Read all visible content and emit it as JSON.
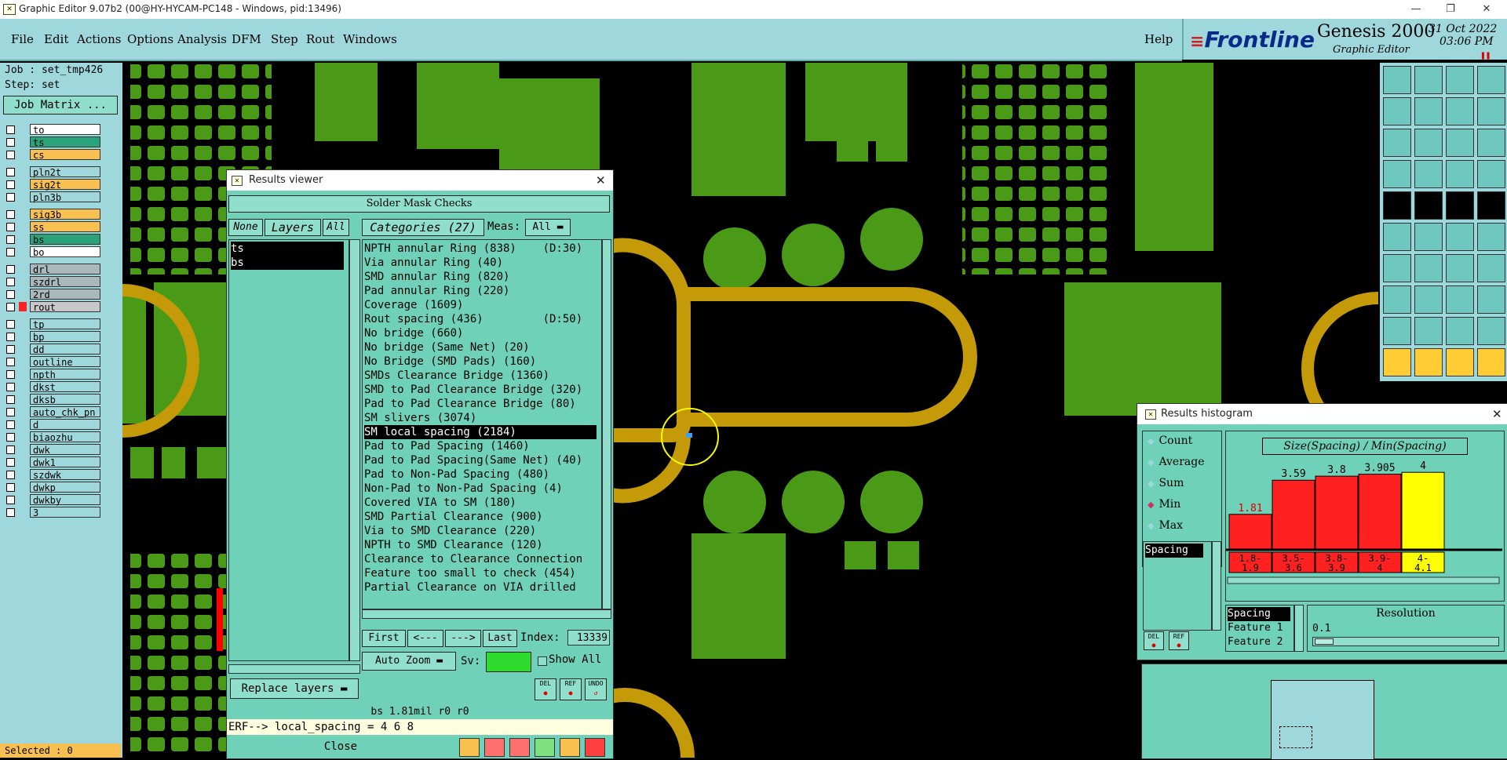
{
  "window": {
    "title": "Graphic Editor 9.07b2 (00@HY-HYCAM-PC148 - Windows, pid:13496)"
  },
  "menu": [
    "File",
    "Edit",
    "Actions",
    "Options",
    "Analysis",
    "DFM",
    "Step",
    "Rout",
    "Windows"
  ],
  "help": "Help",
  "brand": {
    "logo": "Frontline",
    "product": "Genesis 2000",
    "subtitle": "Graphic Editor",
    "date": "31 Oct 2022",
    "time": "03:06 PM"
  },
  "job": {
    "job": "Job : set_tmp426",
    "step": "Step: set",
    "matrix": "Job Matrix ..."
  },
  "layers": [
    {
      "name": "to",
      "color": "#ffffff"
    },
    {
      "name": "ts",
      "color": "#2aa37a"
    },
    {
      "name": "cs",
      "color": "#f8c050"
    },
    {
      "name": "pln2t",
      "color": "#9fd8dc"
    },
    {
      "name": "sig2t",
      "color": "#f8c050"
    },
    {
      "name": "pln3b",
      "color": "#9fd8dc"
    },
    {
      "name": "sig3b",
      "color": "#f8c050"
    },
    {
      "name": "ss",
      "color": "#f8c050"
    },
    {
      "name": "bs",
      "color": "#2aa37a"
    },
    {
      "name": "bo",
      "color": "#ffffff"
    },
    {
      "name": "drl",
      "color": "#a8b8bc"
    },
    {
      "name": "szdrl",
      "color": "#a8b8bc"
    },
    {
      "name": "2rd",
      "color": "#a8b8bc"
    },
    {
      "name": "rout",
      "color": "#c8c8c8"
    },
    {
      "name": "tp",
      "color": "#9fd8dc"
    },
    {
      "name": "bp",
      "color": "#9fd8dc"
    },
    {
      "name": "dd",
      "color": "#9fd8dc"
    },
    {
      "name": "outline",
      "color": "#9fd8dc"
    },
    {
      "name": "npth",
      "color": "#9fd8dc"
    },
    {
      "name": "dkst",
      "color": "#9fd8dc"
    },
    {
      "name": "dksb",
      "color": "#9fd8dc"
    },
    {
      "name": "auto_chk_pn",
      "color": "#9fd8dc"
    },
    {
      "name": "d",
      "color": "#9fd8dc"
    },
    {
      "name": "biaozhu",
      "color": "#9fd8dc"
    },
    {
      "name": "dwk",
      "color": "#9fd8dc"
    },
    {
      "name": "dwk1",
      "color": "#9fd8dc"
    },
    {
      "name": "szdwk",
      "color": "#9fd8dc"
    },
    {
      "name": "dwkp",
      "color": "#9fd8dc"
    },
    {
      "name": "dwkby",
      "color": "#9fd8dc"
    },
    {
      "name": "3",
      "color": "#9fd8dc"
    }
  ],
  "status": {
    "selected": "Selected : 0"
  },
  "results_viewer": {
    "title": "Results viewer",
    "header": "Solder Mask Checks",
    "none": "None",
    "layers": "Layers",
    "all": "All",
    "categories": "Categories (27)",
    "meas_label": "Meas:",
    "meas_value": "All",
    "layer_list": [
      "ts",
      "bs"
    ],
    "category_list": [
      "NPTH annular Ring (838)    (D:30)",
      "Via annular Ring (40)",
      "SMD annular Ring (820)",
      "Pad annular Ring (220)",
      "Coverage (1609)",
      "Rout spacing (436)         (D:50)",
      "No bridge (660)",
      "No bridge (Same Net) (20)",
      "No Bridge (SMD Pads) (160)",
      "SMDs Clearance Bridge (1360)",
      "SMD to Pad Clearance Bridge (320)",
      "Pad to Pad Clearance Bridge (80)",
      "SM slivers (3074)",
      "SM local spacing (2184)",
      "Pad to Pad Spacing (1460)",
      "Pad to Pad Spacing(Same Net) (40)",
      "Pad to Non-Pad Spacing (480)",
      "Non-Pad to Non-Pad Spacing (4)",
      "Covered VIA to SM (180)",
      "SMD Partial Clearance (900)",
      "Via to SMD Clearance (220)",
      "NPTH to SMD Clearance (120)",
      "Clearance to Clearance Connection",
      "Feature too small to check (454)",
      "Partial Clearance on VIA drilled"
    ],
    "selected_index": 13,
    "first": "First",
    "prev": "<---",
    "next": "--->",
    "last": "Last",
    "index_label": "Index:",
    "index_value": "13339",
    "auto_zoom": "Auto Zoom",
    "sv": "Sv:",
    "show_all": "Show All",
    "replace_layers": "Replace layers",
    "del": "DEL",
    "ref": "REF",
    "undo": "UNDO",
    "info": "bs 1.81mil  r0  r0",
    "erf": "ERF--> local_spacing = 4 6 8",
    "close": "Close"
  },
  "histogram": {
    "title": "Results histogram",
    "options": [
      "Count",
      "Average",
      "Sum",
      "Min",
      "Max"
    ],
    "selected_option": "Min",
    "field": "Spacing",
    "heading": "Size(Spacing) / Min(Spacing)",
    "del": "DEL",
    "ref": "REF",
    "attrs": [
      "Spacing",
      "Feature 1",
      "Feature 2"
    ],
    "resolution_label": "Resolution",
    "resolution_value": "0.1",
    "red": "#ff2020",
    "yellow": "#ffff00"
  },
  "chart_data": {
    "type": "bar",
    "categories": [
      "1.8-1.9",
      "3.5-3.6",
      "3.8-3.9",
      "3.9-4",
      "4-4.1"
    ],
    "values": [
      1.81,
      3.59,
      3.8,
      3.905,
      4
    ],
    "value_labels": [
      "1.81",
      "3.59",
      "3.8",
      "3.905",
      "4"
    ],
    "title": "Size(Spacing) / Min(Spacing)",
    "ylim": [
      0,
      4.5
    ]
  }
}
